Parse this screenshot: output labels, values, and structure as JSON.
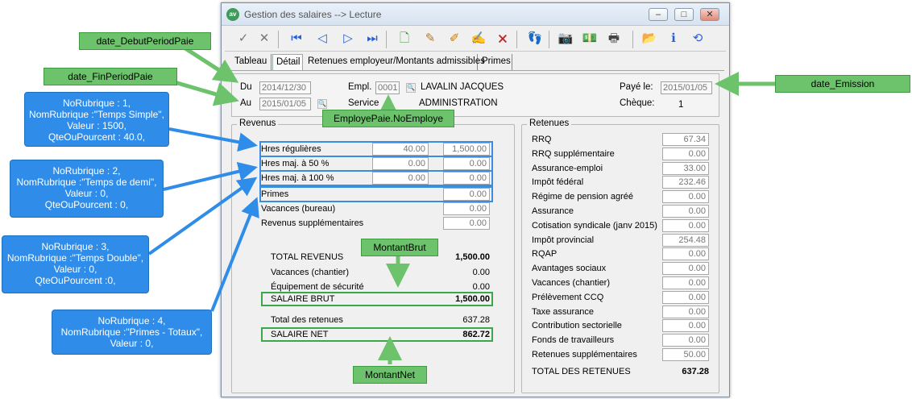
{
  "window": {
    "title": "Gestion des salaires  --> Lecture",
    "logo": "av",
    "controls": {
      "minimize": "–",
      "maximize": "□",
      "close": "✕"
    }
  },
  "toolbar": {
    "icons": [
      "check-icon",
      "cross-icon",
      "first-icon",
      "prev-icon",
      "next-icon",
      "last-icon",
      "add-doc-icon",
      "edit-icon",
      "edit-multi-icon",
      "edit-list-icon",
      "delete-doc-icon",
      "footprints-icon",
      "camera-icon",
      "money-icon",
      "print-icon",
      "folder-icon",
      "info-icon",
      "refresh-icon"
    ]
  },
  "tabs": [
    "Tableau",
    "Détail",
    "Retenues employeur/Montants admissibles",
    "Primes"
  ],
  "header": {
    "du_label": "Du",
    "du_value": "2014/12/30",
    "au_label": "Au",
    "au_value": "2015/01/05",
    "empl_label": "Empl.",
    "empl_value": "0001",
    "empl_name": "LAVALIN JACQUES",
    "service_label": "Service",
    "service_value": "ADMINISTRATION",
    "paye_label": "Payé le:",
    "paye_value": "2015/01/05",
    "cheque_label": "Chèque:",
    "cheque_value": "1"
  },
  "revenus": {
    "title": "Revenus",
    "rows": [
      {
        "label": "Hres régulières",
        "qty": "40.00",
        "amount": "1,500.00"
      },
      {
        "label": "Hres maj. à 50 %",
        "qty": "0.00",
        "amount": "0.00"
      },
      {
        "label": "Hres maj. à 100 %",
        "qty": "0.00",
        "amount": "0.00"
      },
      {
        "label": "Primes",
        "amount": "0.00"
      },
      {
        "label": "Vacances (bureau)",
        "amount": "0.00"
      },
      {
        "label": "Revenus supplémentaires",
        "amount": "0.00"
      }
    ],
    "total_revenus_label": "TOTAL REVENUS",
    "total_revenus": "1,500.00",
    "vacances_chantier_label": "Vacances  (chantier)",
    "vacances_chantier": "0.00",
    "equipement_label": "Équipement de sécurité",
    "equipement": "0.00",
    "salaire_brut_label": "SALAIRE BRUT",
    "salaire_brut": "1,500.00",
    "total_retenues_label": "Total des retenues",
    "total_retenues": "637.28",
    "salaire_net_label": "SALAIRE NET",
    "salaire_net": "862.72"
  },
  "retenues": {
    "title": "Retenues",
    "rows": [
      {
        "label": "RRQ",
        "value": "67.34"
      },
      {
        "label": "RRQ supplémentaire",
        "value": "0.00"
      },
      {
        "label": "Assurance-emploi",
        "value": "33.00"
      },
      {
        "label": "Impôt fédéral",
        "value": "232.46"
      },
      {
        "label": "Régime de pension agréé",
        "value": "0.00"
      },
      {
        "label": "Assurance",
        "value": "0.00"
      },
      {
        "label": "Cotisation syndicale  (janv 2015)",
        "value": "0.00"
      },
      {
        "label": "Impôt provincial",
        "value": "254.48"
      },
      {
        "label": "RQAP",
        "value": "0.00"
      },
      {
        "label": "Avantages sociaux",
        "value": "0.00"
      },
      {
        "label": "Vacances (chantier)",
        "value": "0.00"
      },
      {
        "label": "Prélèvement CCQ",
        "value": "0.00"
      },
      {
        "label": "Taxe assurance",
        "value": "0.00"
      },
      {
        "label": "Contribution sectorielle",
        "value": "0.00"
      },
      {
        "label": "Fonds de travailleurs",
        "value": "0.00"
      },
      {
        "label": "Retenues supplémentaires",
        "value": "50.00"
      }
    ],
    "total_label": "TOTAL DES RETENUES",
    "total": "637.28"
  },
  "annotations": {
    "date_debut": "date_DebutPeriodPaie",
    "date_fin": "date_FinPeriodPaie",
    "date_emission": "date_Emission",
    "employe": "EmployePaie.NoEmploye",
    "montant_brut": "MontantBrut",
    "montant_net": "MontantNet",
    "rubrique1": "NoRubrique : 1,\nNomRubrique :\"Temps Simple\",\nValeur : 1500,\nQteOuPourcent : 40.0,",
    "rubrique2": "NoRubrique : 2,\nNomRubrique :\"Temps de demi\",\nValeur : 0,\nQteOuPourcent : 0,",
    "rubrique3": "NoRubrique : 3,\nNomRubrique :\"Temps Double\",\nValeur : 0,\nQteOuPourcent :0,",
    "rubrique4": "NoRubrique : 4,\nNomRubrique :\"Primes - Totaux\",\nValeur : 0,"
  },
  "colors": {
    "annotation_green": "#6cc36c",
    "annotation_blue": "#2f8de9",
    "highlight_blue": "#3a8ee0",
    "highlight_green": "#3aa84a"
  }
}
